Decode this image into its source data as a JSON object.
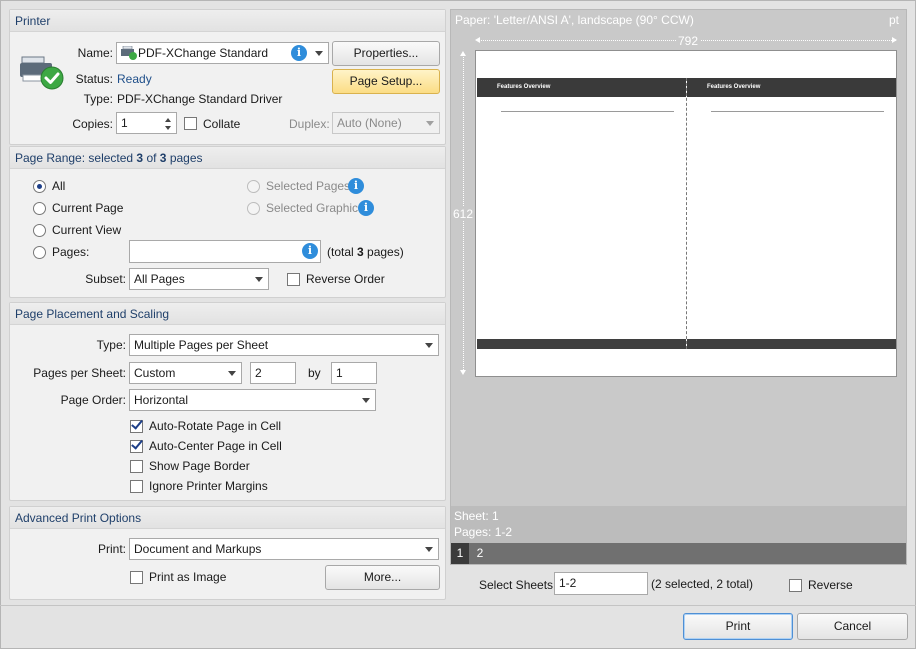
{
  "printer": {
    "section_title": "Printer",
    "name_label": "Name:",
    "name_value": "PDF-XChange Standard",
    "properties_btn": "Properties...",
    "status_label": "Status:",
    "status_value": "Ready",
    "type_label": "Type:",
    "type_value": "PDF-XChange Standard Driver",
    "page_setup_btn": "Page Setup...",
    "copies_label": "Copies:",
    "copies_value": "1",
    "collate_label": "Collate",
    "duplex_label": "Duplex:",
    "duplex_value": "Auto (None)"
  },
  "page_range": {
    "title_prefix": "Page Range: selected ",
    "title_sel": "3",
    "title_mid": " of ",
    "title_total": "3",
    "title_suffix": " pages",
    "all": "All",
    "current_page": "Current Page",
    "current_view": "Current View",
    "pages": "Pages:",
    "pages_value": "",
    "total_prefix": "(total ",
    "total_num": "3",
    "total_suffix": " pages)",
    "selected_pages": "Selected Pages",
    "selected_graphic": "Selected Graphic",
    "subset_label": "Subset:",
    "subset_value": "All Pages",
    "reverse_order": "Reverse Order"
  },
  "placement": {
    "title": "Page Placement and Scaling",
    "type_label": "Type:",
    "type_value": "Multiple Pages per Sheet",
    "pps_label": "Pages per Sheet:",
    "pps_value": "Custom",
    "cols": "2",
    "by": "by",
    "rows": "1",
    "order_label": "Page Order:",
    "order_value": "Horizontal",
    "auto_rotate": "Auto-Rotate Page in Cell",
    "auto_center": "Auto-Center Page in Cell",
    "show_border": "Show Page Border",
    "ignore_margins": "Ignore Printer Margins"
  },
  "advanced": {
    "title": "Advanced Print Options",
    "print_label": "Print:",
    "print_value": "Document and Markups",
    "print_as_image": "Print as Image",
    "more_btn": "More..."
  },
  "preview": {
    "paper": "Paper: 'Letter/ANSI A', landscape (90° CCW)",
    "unit": "pt",
    "width_label": "792",
    "height_label": "612",
    "page_title": "Features Overview",
    "sheet": "Sheet: 1",
    "pages": "Pages: 1-2",
    "tab1": "1",
    "tab2": "2",
    "select_sheets_label": "Select Sheets:",
    "select_sheets_value": "1-2",
    "selected_info": "(2 selected, 2 total)",
    "reverse": "Reverse"
  },
  "footer": {
    "print_btn": "Print",
    "cancel_btn": "Cancel"
  },
  "icons": {
    "printer": "printer-ready-icon",
    "info": "info-icon"
  },
  "colors": {
    "header_text": "#1f3f6a",
    "accent_blue": "#2f8ddb",
    "status_green": "#2ea043",
    "page_setup_yellow": "#fbdd85"
  }
}
